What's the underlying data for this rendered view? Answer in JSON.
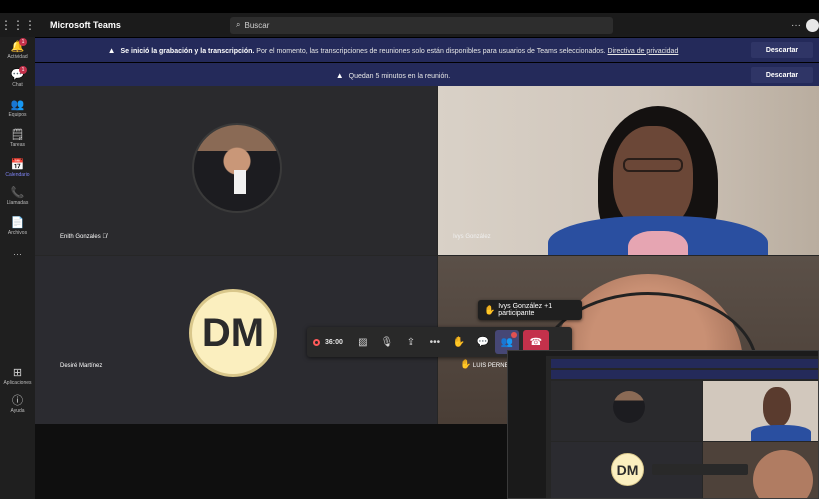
{
  "app": {
    "title": "Microsoft Teams",
    "search_placeholder": "Buscar",
    "more": "···"
  },
  "rail": [
    {
      "label": "Actividad",
      "icon": "bell-icon",
      "glyph": "🔔",
      "badge": "1"
    },
    {
      "label": "Chat",
      "icon": "chat-icon",
      "glyph": "💬",
      "badge": "1"
    },
    {
      "label": "Equipos",
      "icon": "teams-icon",
      "glyph": "👥",
      "badge": ""
    },
    {
      "label": "Tareas",
      "icon": "tasks-icon",
      "glyph": "🗒",
      "badge": ""
    },
    {
      "label": "Calendario",
      "icon": "calendar-icon",
      "glyph": "📅",
      "badge": "",
      "active": true
    },
    {
      "label": "Llamadas",
      "icon": "phone-icon",
      "glyph": "📞",
      "badge": ""
    },
    {
      "label": "Archivos",
      "icon": "files-icon",
      "glyph": "📄",
      "badge": ""
    },
    {
      "label": "···",
      "icon": "more-icon",
      "glyph": "",
      "badge": ""
    }
  ],
  "rail_bottom": [
    {
      "label": "Aplicaciones",
      "icon": "apps-icon",
      "glyph": "⊞"
    },
    {
      "label": "Ayuda",
      "icon": "help-icon",
      "glyph": "?"
    }
  ],
  "banners": {
    "recording": {
      "bold": "Se inició la grabación y la transcripción.",
      "text": " Por el momento, las transcripciones de reuniones solo están disponibles para usuarios de Teams seleccionados. ",
      "link": "Directiva de privacidad",
      "button": "Descartar"
    },
    "time": {
      "text": "Quedan 5 minutos en la reunión.",
      "button": "Descartar"
    }
  },
  "participants": {
    "enith": {
      "name": "Enith Gonzales"
    },
    "ivys": {
      "name": "Ivys González"
    },
    "desire": {
      "name": "Desiré Martínez",
      "initials": "DM"
    },
    "luis": {
      "name": "LUIS PERNET"
    }
  },
  "toolbar": {
    "timer": "36:00"
  },
  "tooltip": {
    "text": "Ivys González +1 participante"
  },
  "pip": {
    "initials": "DM"
  }
}
